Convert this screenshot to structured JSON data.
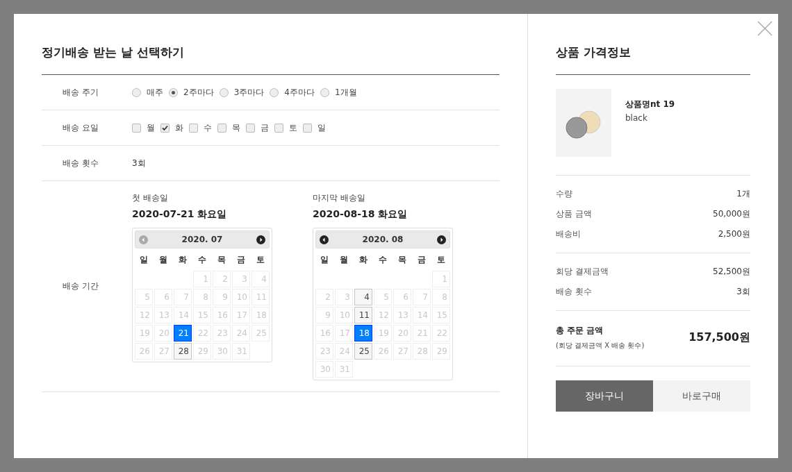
{
  "schedule": {
    "title": "정기배송 받는 날 선택하기",
    "cycle": {
      "label": "배송 주기",
      "options": [
        {
          "label": "매주",
          "selected": false
        },
        {
          "label": "2주마다",
          "selected": true
        },
        {
          "label": "3주마다",
          "selected": false
        },
        {
          "label": "4주마다",
          "selected": false
        },
        {
          "label": "1개월",
          "selected": false
        }
      ]
    },
    "weekdays": {
      "label": "배송 요일",
      "options": [
        {
          "label": "월",
          "checked": false
        },
        {
          "label": "화",
          "checked": true
        },
        {
          "label": "수",
          "checked": false
        },
        {
          "label": "목",
          "checked": false
        },
        {
          "label": "금",
          "checked": false
        },
        {
          "label": "토",
          "checked": false
        },
        {
          "label": "일",
          "checked": false
        }
      ]
    },
    "count": {
      "label": "배송 횟수",
      "value": "3회"
    },
    "period": {
      "label": "배송 기간",
      "calendars": [
        {
          "caption": "첫 배송일",
          "date": "2020-07-21 화요일",
          "month": "2020. 07",
          "prev_disabled": true,
          "day_names": [
            "일",
            "월",
            "화",
            "수",
            "목",
            "금",
            "토"
          ],
          "weeks": [
            [
              {
                "d": "1",
                "selected": false,
                "delivery": false
              },
              {
                "d": "2",
                "selected": false,
                "delivery": false
              },
              {
                "d": "3",
                "selected": false,
                "delivery": false
              },
              {
                "d": "4",
                "selected": false,
                "delivery": false
              }
            ],
            [
              {
                "d": "5",
                "selected": false,
                "delivery": false
              },
              {
                "d": "6",
                "selected": false,
                "delivery": false
              },
              {
                "d": "7",
                "selected": false,
                "delivery": false
              },
              {
                "d": "8",
                "selected": false,
                "delivery": false
              },
              {
                "d": "9",
                "selected": false,
                "delivery": false
              },
              {
                "d": "10",
                "selected": false,
                "delivery": false
              },
              {
                "d": "11",
                "selected": false,
                "delivery": false
              }
            ],
            [
              {
                "d": "12",
                "selected": false,
                "delivery": false
              },
              {
                "d": "13",
                "selected": false,
                "delivery": false
              },
              {
                "d": "14",
                "selected": false,
                "delivery": false
              },
              {
                "d": "15",
                "selected": false,
                "delivery": false
              },
              {
                "d": "16",
                "selected": false,
                "delivery": false
              },
              {
                "d": "17",
                "selected": false,
                "delivery": false
              },
              {
                "d": "18",
                "selected": false,
                "delivery": false
              }
            ],
            [
              {
                "d": "19",
                "selected": false,
                "delivery": false
              },
              {
                "d": "20",
                "selected": false,
                "delivery": false
              },
              {
                "d": "21",
                "selected": true,
                "delivery": true
              },
              {
                "d": "22",
                "selected": false,
                "delivery": false
              },
              {
                "d": "23",
                "selected": false,
                "delivery": false
              },
              {
                "d": "24",
                "selected": false,
                "delivery": false
              },
              {
                "d": "25",
                "selected": false,
                "delivery": false
              }
            ],
            [
              {
                "d": "26",
                "selected": false,
                "delivery": false
              },
              {
                "d": "27",
                "selected": false,
                "delivery": false
              },
              {
                "d": "28",
                "selected": false,
                "delivery": true
              },
              {
                "d": "29",
                "selected": false,
                "delivery": false
              },
              {
                "d": "30",
                "selected": false,
                "delivery": false
              },
              {
                "d": "31",
                "selected": false,
                "delivery": false
              }
            ]
          ]
        },
        {
          "caption": "마지막 배송일",
          "date": "2020-08-18 화요일",
          "month": "2020. 08",
          "prev_disabled": false,
          "day_names": [
            "일",
            "월",
            "화",
            "수",
            "목",
            "금",
            "토"
          ],
          "weeks": [
            [
              {
                "d": "1",
                "selected": false,
                "delivery": false
              }
            ],
            [
              {
                "d": "2",
                "selected": false,
                "delivery": false
              },
              {
                "d": "3",
                "selected": false,
                "delivery": false
              },
              {
                "d": "4",
                "selected": false,
                "delivery": true
              },
              {
                "d": "5",
                "selected": false,
                "delivery": false
              },
              {
                "d": "6",
                "selected": false,
                "delivery": false
              },
              {
                "d": "7",
                "selected": false,
                "delivery": false
              },
              {
                "d": "8",
                "selected": false,
                "delivery": false
              }
            ],
            [
              {
                "d": "9",
                "selected": false,
                "delivery": false
              },
              {
                "d": "10",
                "selected": false,
                "delivery": false
              },
              {
                "d": "11",
                "selected": false,
                "delivery": true
              },
              {
                "d": "12",
                "selected": false,
                "delivery": false
              },
              {
                "d": "13",
                "selected": false,
                "delivery": false
              },
              {
                "d": "14",
                "selected": false,
                "delivery": false
              },
              {
                "d": "15",
                "selected": false,
                "delivery": false
              }
            ],
            [
              {
                "d": "16",
                "selected": false,
                "delivery": false
              },
              {
                "d": "17",
                "selected": false,
                "delivery": false
              },
              {
                "d": "18",
                "selected": true,
                "delivery": true
              },
              {
                "d": "19",
                "selected": false,
                "delivery": false
              },
              {
                "d": "20",
                "selected": false,
                "delivery": false
              },
              {
                "d": "21",
                "selected": false,
                "delivery": false
              },
              {
                "d": "22",
                "selected": false,
                "delivery": false
              }
            ],
            [
              {
                "d": "23",
                "selected": false,
                "delivery": false
              },
              {
                "d": "24",
                "selected": false,
                "delivery": false
              },
              {
                "d": "25",
                "selected": false,
                "delivery": true
              },
              {
                "d": "26",
                "selected": false,
                "delivery": false
              },
              {
                "d": "27",
                "selected": false,
                "delivery": false
              },
              {
                "d": "28",
                "selected": false,
                "delivery": false
              },
              {
                "d": "29",
                "selected": false,
                "delivery": false
              }
            ],
            [
              {
                "d": "30",
                "selected": false,
                "delivery": false
              },
              {
                "d": "31",
                "selected": false,
                "delivery": false
              }
            ]
          ]
        }
      ]
    }
  },
  "price": {
    "title": "상품 가격정보",
    "product": {
      "name": "상품명nt 19",
      "option": "black"
    },
    "groups": [
      [
        {
          "label": "수량",
          "value": "1개"
        },
        {
          "label": "상품 금액",
          "value": "50,000원"
        },
        {
          "label": "배송비",
          "value": "2,500원"
        }
      ],
      [
        {
          "label": "회당 결제금액",
          "value": "52,500원"
        },
        {
          "label": "배송 횟수",
          "value": "3회"
        }
      ]
    ],
    "total": {
      "label": "총 주문 금액",
      "note": "(회당 결제금액 X 배송 횟수)",
      "value": "157,500원"
    },
    "buttons": [
      {
        "label": "장바구니",
        "kind": "primary"
      },
      {
        "label": "바로구매",
        "kind": "secondary"
      }
    ]
  }
}
